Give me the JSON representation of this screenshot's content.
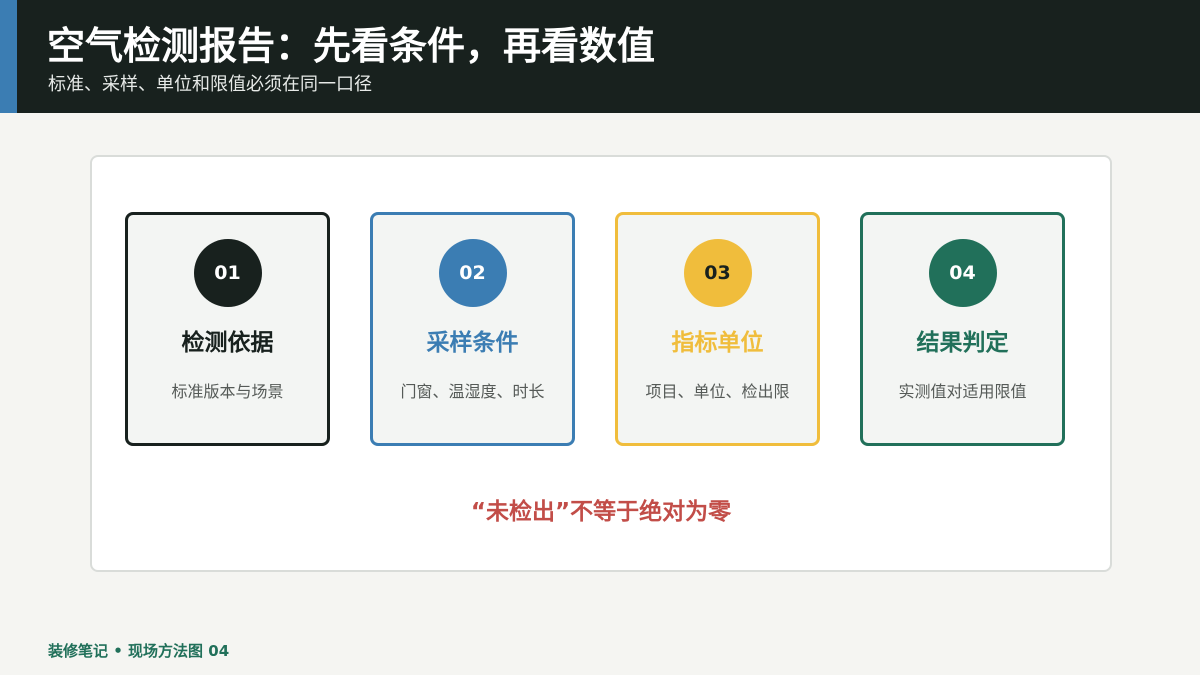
{
  "header": {
    "title": "空气检测报告：先看条件，再看数值",
    "subtitle": "标准、采样、单位和限值必须在同一口径"
  },
  "cards": [
    {
      "number": "01",
      "title": "检测依据",
      "description": "标准版本与场景",
      "color": "#18211e",
      "badge_text_color": "#ffffff"
    },
    {
      "number": "02",
      "title": "采样条件",
      "description": "门窗、温湿度、时长",
      "color": "#3b7db3",
      "badge_text_color": "#ffffff"
    },
    {
      "number": "03",
      "title": "指标单位",
      "description": "项目、单位、检出限",
      "color": "#f0bd3c",
      "badge_text_color": "#18211e"
    },
    {
      "number": "04",
      "title": "结果判定",
      "description": "实测值对适用限值",
      "color": "#21705a",
      "badge_text_color": "#ffffff"
    }
  ],
  "note": {
    "text": "“未检出”不等于绝对为零",
    "color": "#c24d48"
  },
  "footer": {
    "text": "装修笔记 • 现场方法图 04",
    "color": "#21705a"
  },
  "colors": {
    "header_bg": "#18211e",
    "header_accent": "#3b7db3",
    "page_bg": "#f5f5f2"
  }
}
